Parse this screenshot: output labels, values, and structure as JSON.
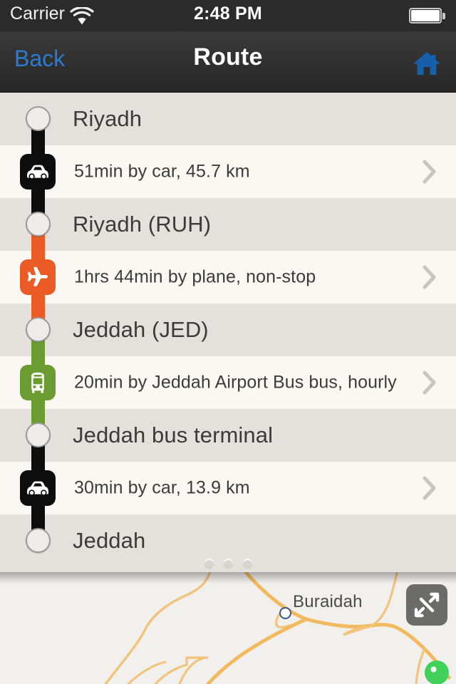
{
  "status_bar": {
    "carrier": "Carrier",
    "time": "2:48 PM",
    "wifi_icon": "wifi-icon",
    "battery_icon": "battery-full-icon"
  },
  "nav_bar": {
    "back_label": "Back",
    "title": "Route",
    "home_icon": "home-icon",
    "back_color": "#2b7bd4",
    "home_color": "#1660ab"
  },
  "route": {
    "rows": [
      {
        "kind": "station",
        "label": "Riyadh"
      },
      {
        "kind": "segment",
        "label": "51min by car, 45.7 km",
        "mode": "car",
        "icon": "car-icon",
        "color": "#0d0d0d"
      },
      {
        "kind": "station",
        "label": "Riyadh (RUH)"
      },
      {
        "kind": "segment",
        "label": "1hrs 44min by plane, non-stop",
        "mode": "plane",
        "icon": "plane-icon",
        "color": "#ea5b25"
      },
      {
        "kind": "station",
        "label": "Jeddah (JED)"
      },
      {
        "kind": "segment",
        "label": "20min by Jeddah Airport Bus bus, hourly",
        "mode": "bus",
        "icon": "bus-icon",
        "color": "#6b9c32"
      },
      {
        "kind": "station",
        "label": "Jeddah bus terminal"
      },
      {
        "kind": "segment",
        "label": "30min by car, 13.9 km",
        "mode": "car",
        "icon": "car-icon",
        "color": "#0d0d0d"
      },
      {
        "kind": "station",
        "label": "Jeddah"
      }
    ],
    "chevron_icon": "chevron-right-icon",
    "station_row_bg": "#e4e1dd",
    "segment_row_bg": "#fbf7f3",
    "grabber_icon": "grabber-dots"
  },
  "map": {
    "city_label": "Buraidah",
    "city_marker_icon": "map-circle-marker",
    "destination_pin_icon": "map-pin-green",
    "expand_icon": "expand-arrows-icon",
    "road_color": "#f0b55a",
    "background_color": "#f2f0ed"
  }
}
